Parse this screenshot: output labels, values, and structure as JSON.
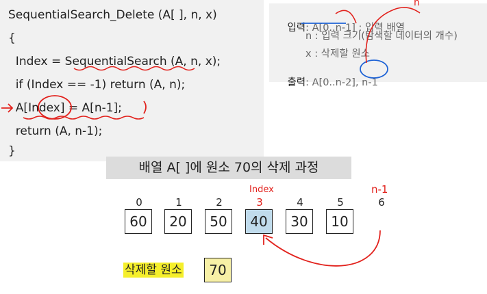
{
  "code": {
    "lines": [
      "SequentialSearch_Delete (A[ ], n, x)",
      "{",
      "  Index = SequentialSearch (A, n, x);",
      "  if (Index == -1) return (A, n);",
      "  A[Index] = A[n-1];",
      "  return (A, n-1);",
      "}"
    ]
  },
  "io": {
    "input_key": "입력",
    "input_array": "A[0..n-1] : 입력 배열",
    "input_n": "n : 입력 크기(탐색할 데이터의 개수)",
    "input_x": "x : 삭제할 원소",
    "output_key": "출력",
    "output_value": "A[0..n-2], n-1"
  },
  "title": "배열 A[ ]에 원소 70의 삭제 과정",
  "array": {
    "indices": [
      "0",
      "1",
      "2",
      "3",
      "4",
      "5",
      "6"
    ],
    "values": [
      "60",
      "20",
      "50",
      "40",
      "30",
      "10"
    ],
    "highlight_index": 3
  },
  "annotations": {
    "index_label": "Index",
    "n_minus_1_label": "n-1",
    "top_mark": "n"
  },
  "delete": {
    "label": "삭제할 원소",
    "value": "70"
  },
  "colors": {
    "highlight_cell": "#c0dbec",
    "delete_label_bg": "#f5ef2b",
    "delete_value_bg": "#f7f0a6",
    "annotation_red": "#e2221d",
    "annotation_blue": "#1f64d6"
  }
}
